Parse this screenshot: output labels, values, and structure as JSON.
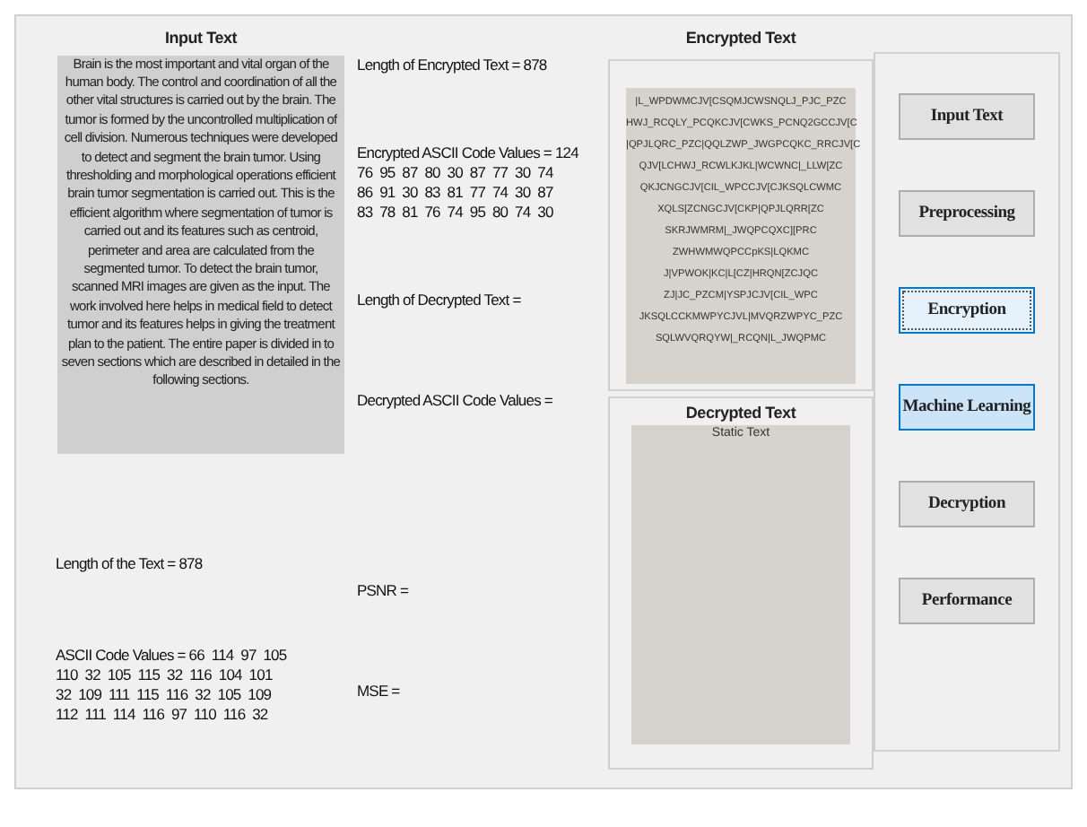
{
  "input_panel": {
    "title": "Input Text",
    "text": "Brain is the most important and vital organ of the human body. The control and coordination of all the other vital structures is carried out by the brain. The tumor is formed by the uncontrolled multiplication of cell division. Numerous techniques were developed to detect and segment the brain tumor. Using thresholding and morphological operations efficient brain tumor segmentation is carried out. This is the efficient algorithm where segmentation of tumor is carried out and its features such as centroid, perimeter and area are calculated from the segmented tumor. To detect the brain tumor, scanned MRI images are given as the input. The work involved here helps in medical field to detect tumor and its features helps in giving the treatment plan to the patient. The entire paper is divided in to seven sections which are described in detailed in the following sections."
  },
  "length_of_text": "Length of the Text = 878",
  "ascii_values": [
    "ASCII Code Values = 66  114  97  105",
    "110  32  105  115  32  116  104  101",
    "32  109  111  115  116  32  105  109",
    "112  111  114  116  97  110  116  32"
  ],
  "length_encrypted": "Length of Encrypted Text = 878",
  "encrypted_ascii": [
    "Encrypted ASCII Code Values = 124",
    "76  95  87  80  30  87  77  30  74",
    "86  91  30  83  81  77  74  30  87",
    "83  78  81  76  74  95  80  74  30"
  ],
  "length_decrypted": "Length of Decrypted Text =",
  "decrypted_ascii": "Decrypted ASCII Code Values =",
  "psnr": "PSNR =",
  "mse": "MSE =",
  "encrypted_panel": {
    "title": "Encrypted Text",
    "lines": [
      "|L_WPDWMCJV[CSQMJCWSNQLJ_PJC_PZC",
      "HWJ_RCQLY_PCQKCJV[CWKS_PCNQ2GCCJV[C",
      "|QPJLQRC_PZC|QQLZWP_JWGPCQKC_RRCJV[C",
      "QJV[LCHWJ_RCWLKJKL|WCWNC|_LLW[ZC",
      "QKJCNGCJV[CIL_WPCCJV[CJKSQLCWMC",
      "XQLS[ZCNGCJV[CKP|QPJLQRR[ZC",
      "SKRJWMRM|_JWQPCQXC][PRC",
      "ZWHWMWQPCCpKS|LQKMC",
      "J|VPWOK|KC|L[CZ|HRQN[ZCJQC",
      "ZJ|JC_PZCM|YSPJCJV[CIL_WPC",
      "JKSQLCCKMWPYCJVL|MVQRZWPYC_PZC",
      "SQLWVQRQYW|_RCQN|L_JWQPMC"
    ]
  },
  "decrypted_panel": {
    "title": "Decrypted Text",
    "text": "Static Text"
  },
  "buttons": [
    {
      "label": "Input Text",
      "focused": false,
      "hovered": false
    },
    {
      "label": "Preprocessing",
      "focused": false,
      "hovered": false
    },
    {
      "label": "Encryption",
      "focused": true,
      "hovered": false
    },
    {
      "label": "Machine Learning",
      "focused": false,
      "hovered": true
    },
    {
      "label": "Decryption",
      "focused": false,
      "hovered": false
    },
    {
      "label": "Performance",
      "focused": false,
      "hovered": false
    }
  ]
}
